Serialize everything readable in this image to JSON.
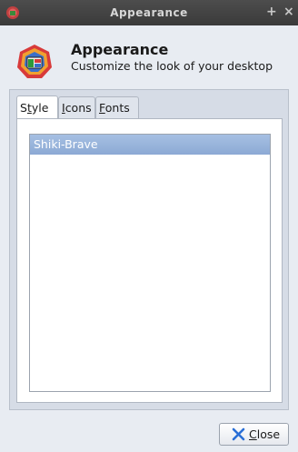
{
  "window": {
    "title": "Appearance",
    "maximize_glyph": "+",
    "close_glyph": "×",
    "app_icon": "appearance-palette-icon"
  },
  "header": {
    "title": "Appearance",
    "subtitle": "Customize the look of your desktop",
    "icon": "appearance-palette-icon"
  },
  "tabs": [
    {
      "label": "Style",
      "mnemonic_index": 1,
      "active": true
    },
    {
      "label": "Icons",
      "mnemonic_index": 0,
      "active": false
    },
    {
      "label": "Fonts",
      "mnemonic_index": 0,
      "active": false
    }
  ],
  "style_list": {
    "items": [
      "Shiki-Brave"
    ],
    "selected": "Shiki-Brave"
  },
  "footer": {
    "close_label": "Close",
    "close_icon": "close-x-icon"
  },
  "colors": {
    "selection": "#93afd8",
    "titlebar": "#3f3f3f",
    "close_x": "#2a6fd6"
  }
}
